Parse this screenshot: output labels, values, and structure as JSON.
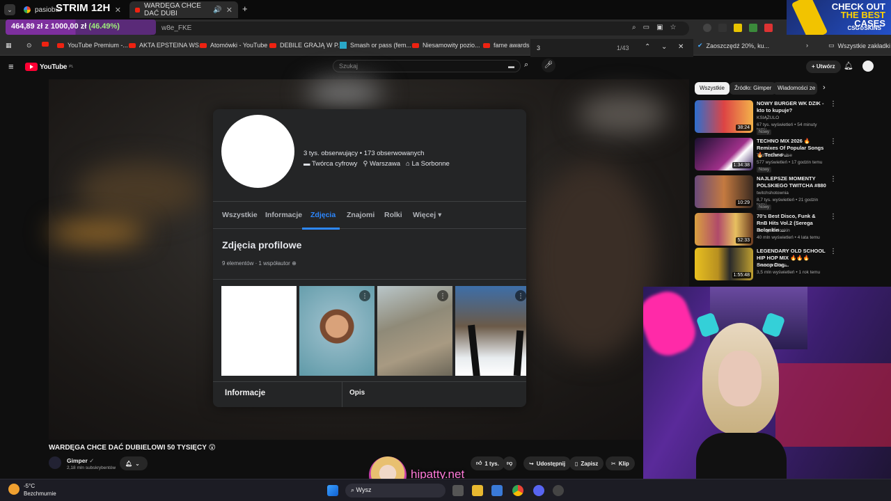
{
  "stream": {
    "title": "STRIM 12H"
  },
  "donation": {
    "amount": "464,89 zł",
    "of": "z",
    "goal": "1000,00 zł",
    "percent": "(46.49%)"
  },
  "tabs": [
    {
      "label": "pasiobur"
    },
    {
      "label": "WARDĘGA CHCE DAĆ DUBI"
    }
  ],
  "address": {
    "url": "w8e_FKE"
  },
  "bookmarks": [
    {
      "label": "YouTube Premium -..."
    },
    {
      "label": "AKTA EPSTEINA WS..."
    },
    {
      "label": "Atomówki - YouTube"
    },
    {
      "label": "DEBILE GRAJĄ W P..."
    },
    {
      "label": "Smash or pass (fem..."
    },
    {
      "label": "Niesamowity pozio..."
    },
    {
      "label": "fame awards -"
    },
    {
      "label": "Zaoszczędź 20%, ku..."
    },
    {
      "label": "Wszystkie zakładki"
    }
  ],
  "findbar": {
    "query": "3",
    "count": "1/43"
  },
  "ad": {
    "line1": "CHECK OUT",
    "line2": "THE BEST",
    "line3": "CASES",
    "brand": "CSG⊙SKINS"
  },
  "youtube": {
    "logo": "YouTube",
    "region": "PL",
    "search_placeholder": "Szukaj",
    "create_label": "Utwórz",
    "video_title": "WARDĘGA CHCE DAĆ DUBIELOWI 50 TYSIĘCY 😲",
    "channel": "Gimper",
    "subscribers": "2,18 mln subskrybentów",
    "likes": "1 tys.",
    "share": "Udostępnij",
    "save": "Zapisz",
    "clip": "Klip"
  },
  "chips": [
    {
      "label": "Wszystkie"
    },
    {
      "label": "Źródło: Gimper"
    },
    {
      "label": "Wiadomości ze ś"
    }
  ],
  "recommendations": [
    {
      "title": "NOWY BURGER WK DZIK - kto to kupuje?",
      "channel": "KSIĄŻULO",
      "meta": "67 tys. wyświetleń • 54 minuty temu",
      "badge": "Nowy",
      "duration": "38:24"
    },
    {
      "title": "TECHNO MIX 2026 🔥 Remixes Of Popular Songs 🔥 Techno ...",
      "channel": "TechnoDarkPulse",
      "meta": "577 wyświetleń • 17 godzin temu",
      "badge": "Nowy",
      "duration": "1:34:38"
    },
    {
      "title": "NAJLEPSZE MOMENTY POLSKIEGO TWITCHA #880",
      "channel": "twitchshotownia",
      "meta": "8,7 tys. wyświetleń • 21 godzin temu",
      "badge": "Nowy",
      "duration": "10:29"
    },
    {
      "title": "70's Best Disco, Funk & RnB Hits Vol.2 (Serega Bolonkin ...",
      "channel": "Serega Bolonkin",
      "meta": "40 mln wyświetleń • 4 lata temu",
      "badge": "",
      "duration": "52:33"
    },
    {
      "title": "LEGENDARY OLD SCHOOL HIP HOP MIX 🔥🔥🔥 Snoop Dog...",
      "channel": "Deus em Casa",
      "meta": "3,5 mln wyświetleń • 1 rok temu",
      "badge": "",
      "duration": "1:55:48"
    }
  ],
  "fb": {
    "stats": "3 tys. obserwujący • 173 obserwowanych",
    "creator": "Twórca cyfrowy",
    "city": "Warszawa",
    "school": "La Sorbonne",
    "tabs": [
      "Wszystkie",
      "Informacje",
      "Zdjęcia",
      "Znajomi",
      "Rolki",
      "Więcej ▾"
    ],
    "section_title": "Zdjęcia profilowe",
    "section_meta": "9 elementów · 1 współautor",
    "info_label": "Informacje",
    "desc_label": "Opis"
  },
  "overlay": {
    "site": "hipatty.net"
  },
  "taskbar": {
    "temp": "-5°C",
    "weather": "Bezchmurnie",
    "search": "Wysz"
  },
  "colors": {
    "youtube_red": "#ff0033",
    "fb_blue": "#2d88ff",
    "donation_purple": "#7d2f9e",
    "donation_pct": "#9ef07a"
  }
}
